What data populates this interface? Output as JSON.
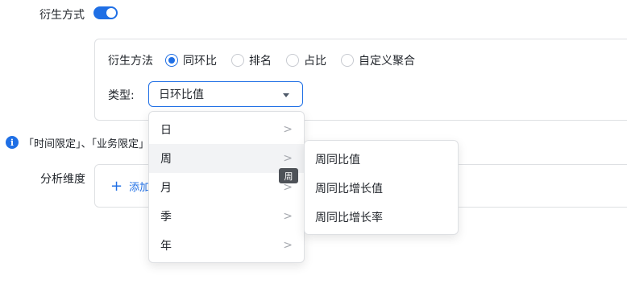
{
  "derive": {
    "label": "衍生方式",
    "enabled": true
  },
  "method": {
    "label": "衍生方法",
    "options": [
      {
        "label": "同环比",
        "checked": true
      },
      {
        "label": "排名",
        "checked": false
      },
      {
        "label": "占比",
        "checked": false
      },
      {
        "label": "自定义聚合",
        "checked": false
      }
    ]
  },
  "type": {
    "label": "类型:",
    "value": "日环比值"
  },
  "info": {
    "text": "「时间限定」、「业务限定」"
  },
  "analysis": {
    "label": "分析维度",
    "add_label": "添加"
  },
  "menu": {
    "items": [
      {
        "label": "日",
        "arrow": ">"
      },
      {
        "label": "周",
        "arrow": ">"
      },
      {
        "label": "月",
        "arrow": ">"
      },
      {
        "label": "季",
        "arrow": ">"
      },
      {
        "label": "年",
        "arrow": ">"
      }
    ],
    "active_index": 1
  },
  "submenu": {
    "items": [
      "周同比值",
      "周同比增长值",
      "周同比增长率"
    ]
  },
  "tooltip": {
    "text": "周"
  },
  "colors": {
    "primary": "#1f6fe5",
    "border": "#dee0e3",
    "hover_bg": "#f2f3f5",
    "tooltip_bg": "#4e5258"
  }
}
